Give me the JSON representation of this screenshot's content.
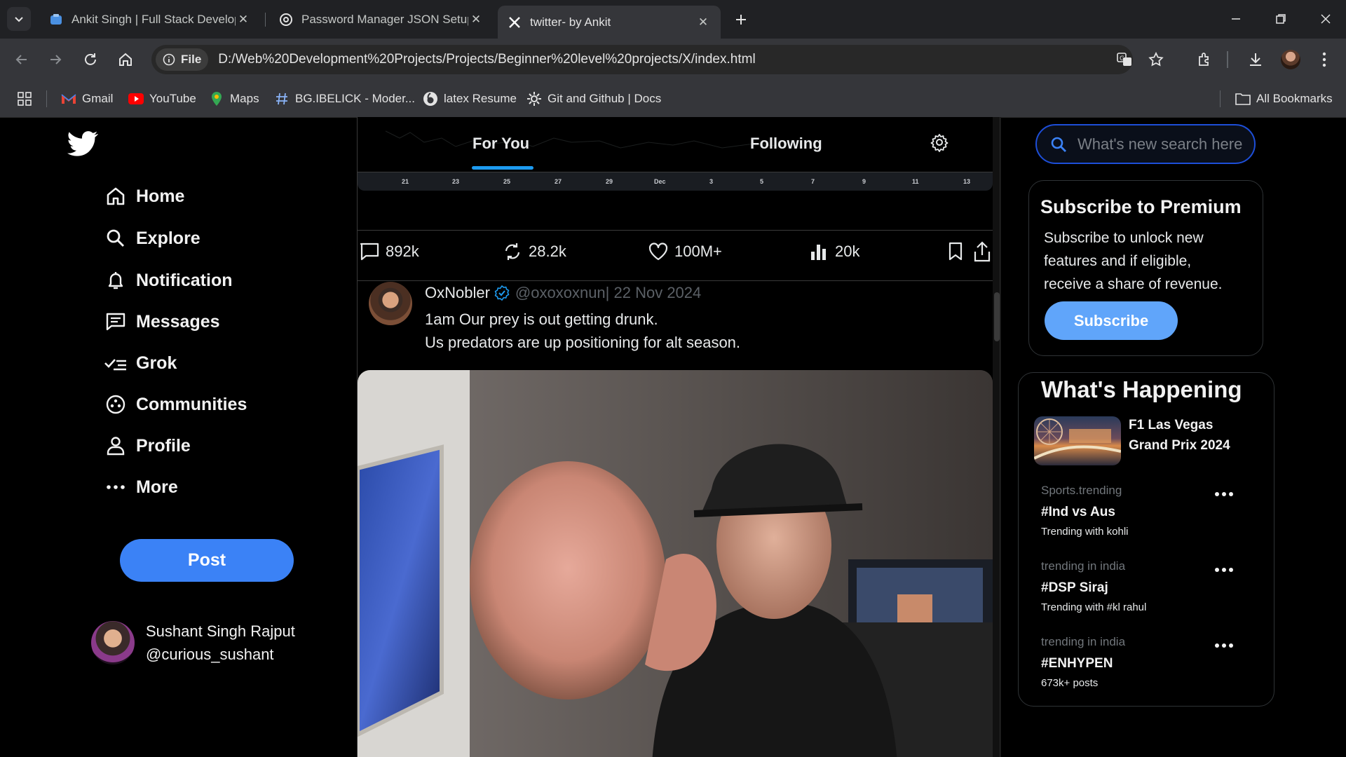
{
  "browser": {
    "tabs": [
      {
        "title": "Ankit Singh | Full Stack Develop"
      },
      {
        "title": "Password Manager JSON Setup"
      },
      {
        "title": "twitter- by Ankit"
      }
    ],
    "address": {
      "scheme_label": "File",
      "url": "D:/Web%20Development%20Projects/Projects/Beginner%20level%20projects/X/index.html"
    },
    "bookmarks": [
      {
        "label": "Gmail"
      },
      {
        "label": "YouTube"
      },
      {
        "label": "Maps"
      },
      {
        "label": "BG.IBELICK - Moder..."
      },
      {
        "label": "latex Resume"
      },
      {
        "label": "Git and Github | Docs"
      }
    ],
    "all_bookmarks": "All Bookmarks"
  },
  "sidebar": {
    "items": [
      {
        "label": "Home",
        "icon": "home-icon"
      },
      {
        "label": "Explore",
        "icon": "search-icon"
      },
      {
        "label": "Notification",
        "icon": "bell-icon"
      },
      {
        "label": "Messages",
        "icon": "message-icon"
      },
      {
        "label": "Grok",
        "icon": "grok-icon"
      },
      {
        "label": "Communities",
        "icon": "communities-icon"
      },
      {
        "label": "Profile",
        "icon": "person-icon"
      },
      {
        "label": "More",
        "icon": "more-icon"
      }
    ],
    "post_label": "Post",
    "profile": {
      "name": "Sushant Singh Rajput",
      "handle": "@curious_sushant"
    }
  },
  "feed": {
    "tabs": [
      {
        "label": "For You"
      },
      {
        "label": "Following"
      }
    ],
    "chart_ticks": [
      "21",
      "23",
      "25",
      "27",
      "29",
      "Dec",
      "3",
      "5",
      "7",
      "9",
      "11",
      "13"
    ],
    "actions": {
      "replies": "892k",
      "reposts": "28.2k",
      "likes": "100M+",
      "views": "20k"
    },
    "tweet": {
      "name": "OxNobler",
      "handle": "@oxoxoxnun| 22 Nov 2024",
      "line1": "1am Our prey is out getting drunk.",
      "line2": "Us predators are up positioning for alt season."
    }
  },
  "right": {
    "search_placeholder": "What's new search here",
    "premium": {
      "title": "Subscribe to Premium",
      "text": "Subscribe to unlock new features and if eligible, receive a share of revenue.",
      "button": "Subscribe"
    },
    "happening": {
      "title": "What's Happening",
      "featured": "F1 Las Vegas Grand Prix 2024",
      "trends": [
        {
          "category": "Sports.trending",
          "tag": "#Ind vs Aus",
          "sub": "Trending with kohli"
        },
        {
          "category": "trending in india",
          "tag": "#DSP Siraj",
          "sub": "Trending with #kl rahul"
        },
        {
          "category": "trending in india",
          "tag": "#ENHYPEN",
          "sub": "673k+ posts"
        }
      ]
    }
  },
  "colors": {
    "accent": "#1d9bf0",
    "post_button": "#3b82f6",
    "subscribe_button": "#60a5fa"
  }
}
